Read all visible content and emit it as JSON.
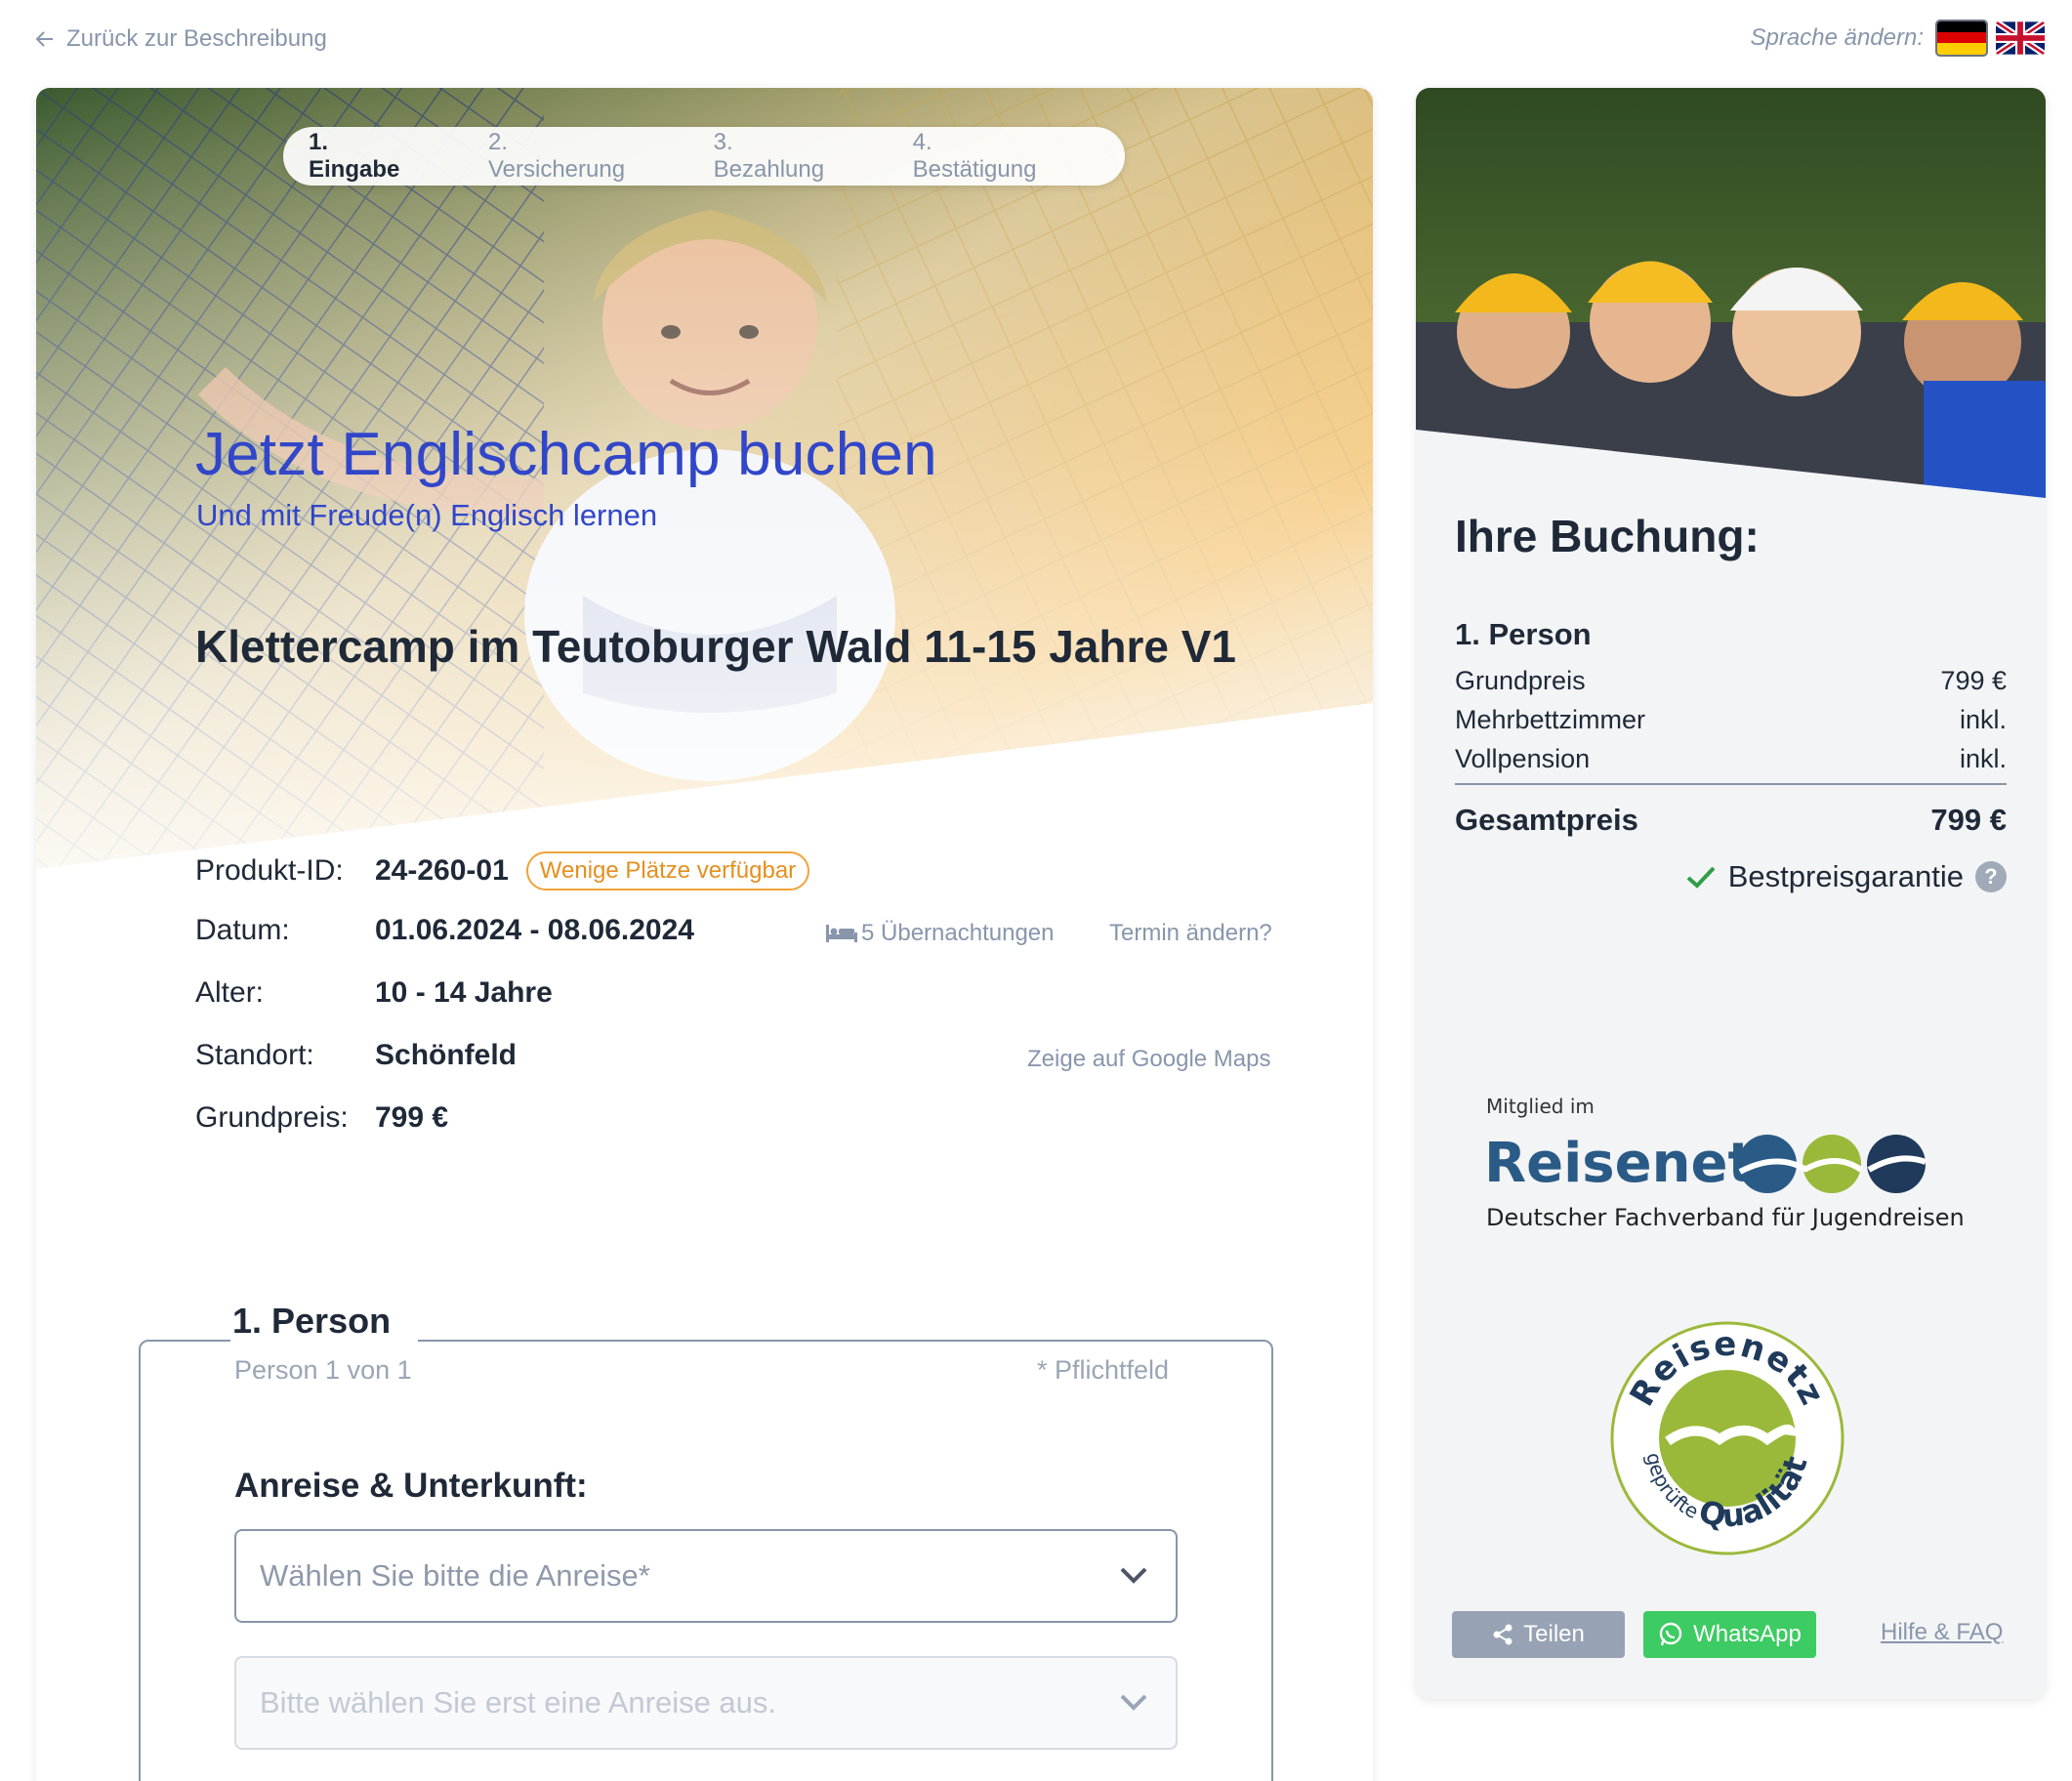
{
  "topbar": {
    "back_label": "Zurück zur Beschreibung",
    "language_label": "Sprache ändern:",
    "languages": [
      "de",
      "en"
    ]
  },
  "stepper": {
    "steps": [
      "1. Eingabe",
      "2. Versicherung",
      "3. Bezahlung",
      "4. Bestätigung"
    ],
    "active_index": 0
  },
  "hero": {
    "title": "Jetzt Englischcamp buchen",
    "subtitle": "Und mit Freude(n) Englisch lernen"
  },
  "product": {
    "title": "Klettercamp im Teutoburger Wald 11-15 Jahre V1",
    "id_label": "Produkt-ID:",
    "id_value": "24-260-01",
    "badge": "Wenige Plätze verfügbar",
    "date_label": "Datum:",
    "date_value": "01.06.2024 - 08.06.2024",
    "nights": "5 Übernachtungen",
    "change_date": "Termin ändern?",
    "age_label": "Alter:",
    "age_value": "10 - 14 Jahre",
    "location_label": "Standort:",
    "location_value": "Schönfeld",
    "maps_link": "Zeige auf Google Maps",
    "price_label": "Grundpreis:",
    "price_value": "799 €"
  },
  "form": {
    "person_title": "1. Person",
    "person_counter": "Person 1 von 1",
    "required_note": "* Pflichtfeld",
    "section_title": "Anreise & Unterkunft:",
    "arrival_placeholder": "Wählen Sie bitte die Anreise*",
    "accommodation_placeholder": "Bitte wählen Sie erst eine Anreise aus."
  },
  "sidebar": {
    "title": "Ihre Buchung:",
    "person": "1. Person",
    "lines": [
      {
        "label": "Grundpreis",
        "value": "799 €"
      },
      {
        "label": "Mehrbettzimmer",
        "value": "inkl."
      },
      {
        "label": "Vollpension",
        "value": "inkl."
      }
    ],
    "total_label": "Gesamtpreis",
    "total_value": "799 €",
    "guarantee": "Bestpreisgarantie",
    "member_logo": {
      "small": "Mitglied im",
      "name": "Reisenetz",
      "tagline": "Deutscher Fachverband für Jugendreisen"
    },
    "seal": {
      "top": "Reisenetz",
      "bottom_small": "geprüfte",
      "bottom_big": "Qualität"
    },
    "share_label": "Teilen",
    "whatsapp_label": "WhatsApp",
    "help_label": "Hilfe & FAQ"
  },
  "colors": {
    "accent_blue": "#3146c9",
    "badge_orange": "#e58f1e",
    "whatsapp_green": "#3dcb63",
    "muted": "#8896ab",
    "reisenetz_blue": "#2a5a86",
    "reisenetz_green": "#9ab93a"
  }
}
